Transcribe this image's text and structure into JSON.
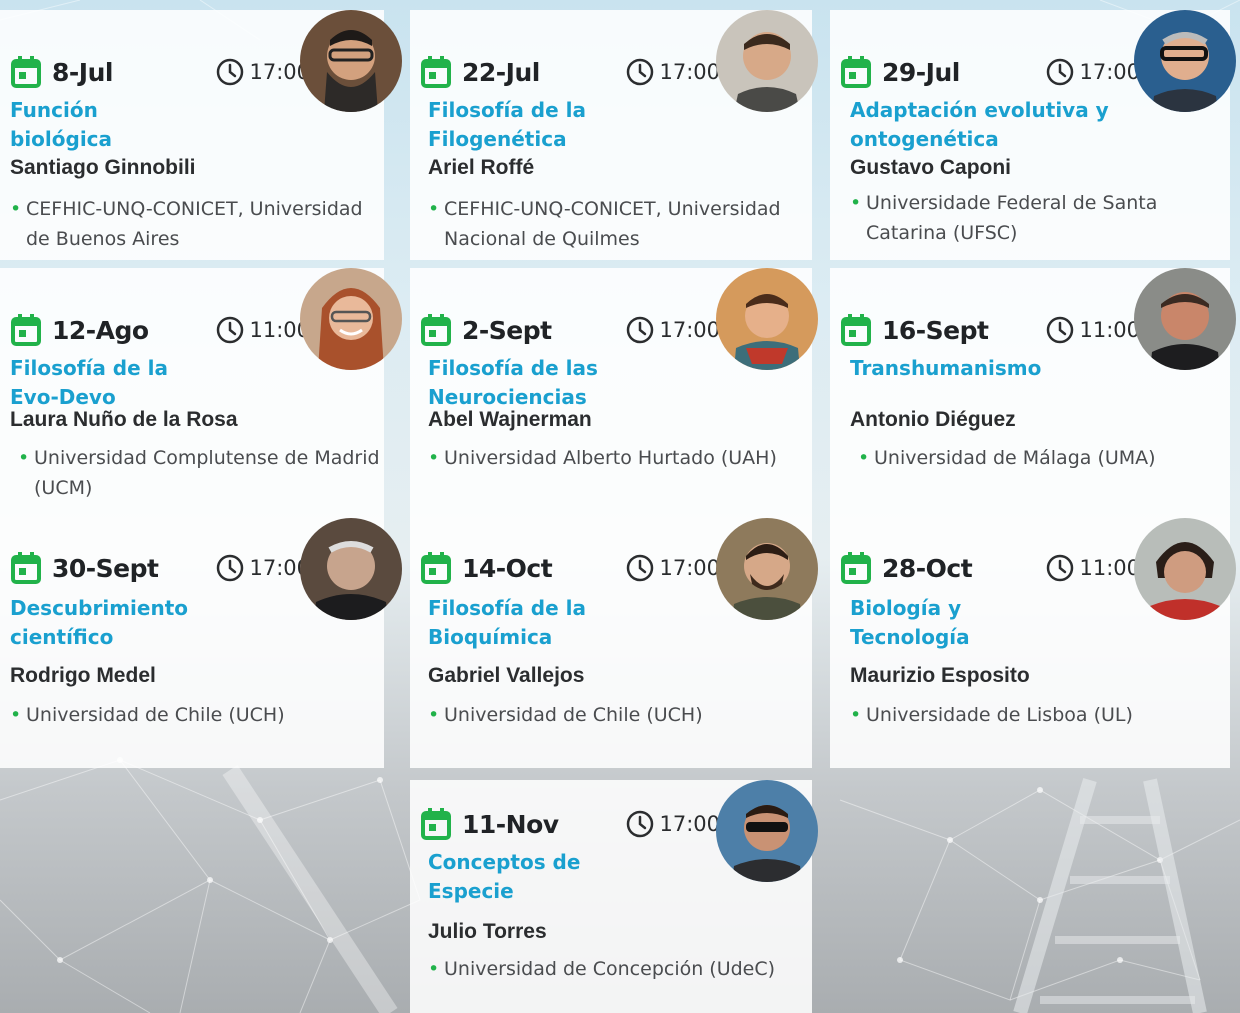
{
  "colors": {
    "accent_green": "#21b24a",
    "topic_blue": "#1aa0cf",
    "text_dark": "#2b2d2f"
  },
  "sessions": [
    {
      "date": "8-Jul",
      "time": "17:00",
      "topic": "Función biológica",
      "speaker": "Santiago Ginnobili",
      "affiliation": "CEFHIC-UNQ-CONICET, Universidad de Buenos Aires"
    },
    {
      "date": "22-Jul",
      "time": "17:00",
      "topic": "Filosofía de la Filogenética",
      "speaker": "Ariel Roffé",
      "affiliation": "CEFHIC-UNQ-CONICET, Universidad Nacional de Quilmes"
    },
    {
      "date": "29-Jul",
      "time": "17:00",
      "topic": "Adaptación evolutiva y ontogenética",
      "speaker": "Gustavo Caponi",
      "affiliation": "Universidade Federal de Santa Catarina (UFSC)"
    },
    {
      "date": "12-Ago",
      "time": "11:00",
      "topic": "Filosofía de la Evo-Devo",
      "speaker": "Laura Nuño de la Rosa",
      "affiliation": "Universidad Complutense de Madrid (UCM)"
    },
    {
      "date": "2-Sept",
      "time": "17:00",
      "topic": "Filosofía de las Neurociencias",
      "speaker": "Abel Wajnerman",
      "affiliation": "Universidad Alberto Hurtado (UAH)"
    },
    {
      "date": "16-Sept",
      "time": "11:00",
      "topic": "Transhumanismo",
      "speaker": "Antonio Diéguez",
      "affiliation": "Universidad de Málaga (UMA)"
    },
    {
      "date": "30-Sept",
      "time": "17:00",
      "topic": "Descubrimiento científico",
      "speaker": "Rodrigo Medel",
      "affiliation": "Universidad de Chile (UCH)"
    },
    {
      "date": "14-Oct",
      "time": "17:00",
      "topic": "Filosofía de la Bioquímica",
      "speaker": "Gabriel Vallejos",
      "affiliation": "Universidad de Chile (UCH)"
    },
    {
      "date": "28-Oct",
      "time": "11:00",
      "topic": "Biología y Tecnología",
      "speaker": "Maurizio Esposito",
      "affiliation": "Universidade de Lisboa (UL)"
    },
    {
      "date": "11-Nov",
      "time": "17:00",
      "topic": "Conceptos de Especie",
      "speaker": "Julio Torres",
      "affiliation": "Universidad de Concepción (UdeC)"
    }
  ]
}
